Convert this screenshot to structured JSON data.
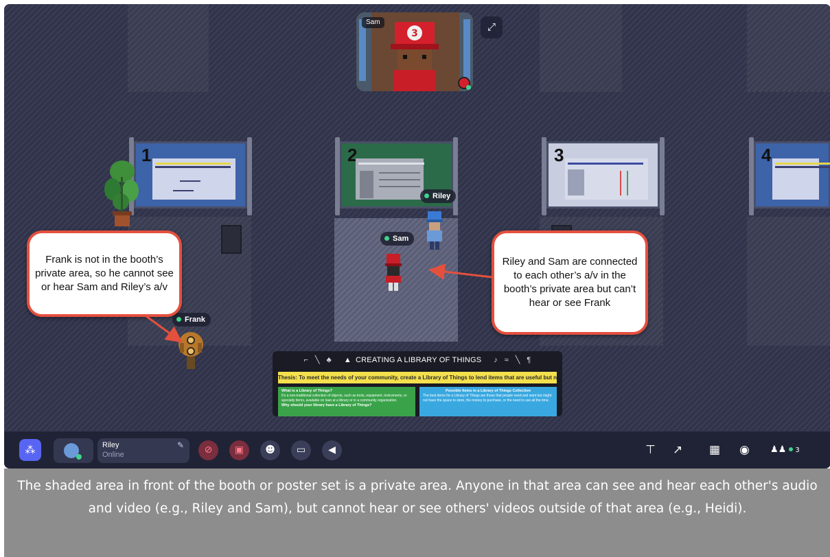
{
  "video": {
    "participant_name": "Sam"
  },
  "booths": [
    {
      "number": "1"
    },
    {
      "number": "2"
    },
    {
      "number": "3"
    },
    {
      "number": "4"
    }
  ],
  "players": {
    "riley": "Riley",
    "sam": "Sam",
    "frank": "Frank"
  },
  "callouts": {
    "left": "Frank is not in the booth’s private area, so he cannot see or hear Sam and Riley’s a/v",
    "right": "Riley and Sam are connected to each other’s a/v in the booth’s private area but can’t hear or see Frank"
  },
  "poster": {
    "title": "CREATING A LIBRARY OF THINGS",
    "thesis": "Thesis: To meet the needs of your community, create a Library of Things to lend items that are useful but not always in use.",
    "left_heading": "What is a Library of Things?",
    "left_body": "It's a non-traditional collection of objects, such as tools, equipment, instruments, or specialty items, available on loan at a library or in a community organization.",
    "left_heading2": "Why should your library have a Library of Things?",
    "right_heading": "Possible Items in a Library of Things Collection",
    "right_body": "The best items for a Library of Things are those that people need and want but might not have the space to store, the money to purchase, or the need to use all the time."
  },
  "toolbar": {
    "user_name": "Riley",
    "user_status": "Online",
    "participant_count": "3"
  },
  "caption": "The shaded area in front of the booth or poster set is a private area. Anyone in that area can see and hear each other's audio and video (e.g., Riley and Sam), but cannot hear or see others' videos outside of that area (e.g., Heidi).",
  "colors": {
    "accent": "#5865f2",
    "online": "#3fd48c",
    "callout_border": "#e4503e",
    "muted_button": "#7a2e3e"
  },
  "icons": [
    "network-icon",
    "mic-off-icon",
    "camera-off-icon",
    "emoji-icon",
    "screen-share-icon",
    "megaphone-icon",
    "podium-icon",
    "build-icon",
    "calendar-icon",
    "chat-icon",
    "participants-icon",
    "expand-icon",
    "edit-icon"
  ]
}
